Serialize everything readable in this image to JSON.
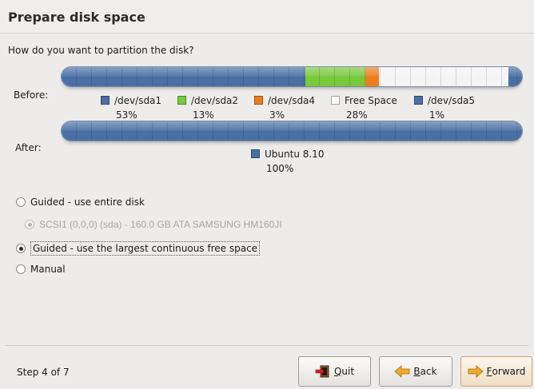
{
  "header": {
    "title": "Prepare disk space"
  },
  "question": "How do you want to partition the disk?",
  "before": {
    "label": "Before:",
    "segments": [
      {
        "name": "/dev/sda1",
        "percent_label": "53%",
        "fraction": 0.53,
        "color": "#4a6fa5"
      },
      {
        "name": "/dev/sda2",
        "percent_label": "13%",
        "fraction": 0.13,
        "color": "#78c93c"
      },
      {
        "name": "/dev/sda4",
        "percent_label": "3%",
        "fraction": 0.03,
        "color": "#ee7d1f"
      },
      {
        "name": "Free Space",
        "percent_label": "28%",
        "fraction": 0.28,
        "color": "#f4f4f4"
      },
      {
        "name": "/dev/sda5",
        "percent_label": "1%",
        "fraction": 0.03,
        "color": "#4a6fa5"
      }
    ]
  },
  "after": {
    "label": "After:",
    "segments": [
      {
        "name": "Ubuntu 8.10",
        "percent_label": "100%",
        "fraction": 1.0,
        "color": "#4a6fa5"
      }
    ]
  },
  "options": {
    "entire_disk": "Guided - use entire disk",
    "disk_choice": "SCSI1 (0,0,0) (sda) - 160.0 GB ATA SAMSUNG HM160JI",
    "largest_free": "Guided - use the largest continuous free space",
    "manual": "Manual"
  },
  "footer": {
    "step": "Step 4 of 7",
    "quit": {
      "mnemonic": "Q",
      "rest": "uit"
    },
    "back": {
      "mnemonic": "B",
      "rest": "ack"
    },
    "forward": {
      "mnemonic": "F",
      "rest": "orward"
    }
  }
}
